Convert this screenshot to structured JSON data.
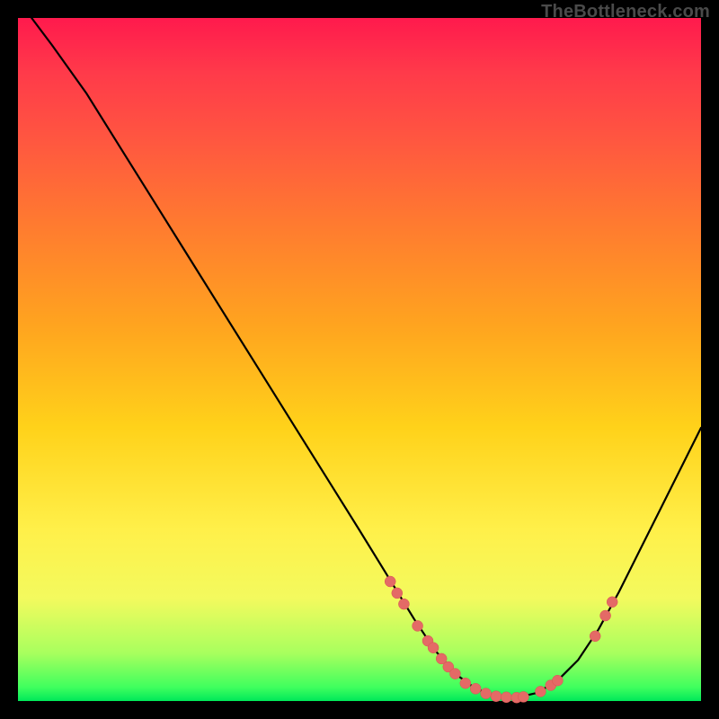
{
  "watermark": "TheBottleneck.com",
  "chart_data": {
    "type": "line",
    "title": "",
    "xlabel": "",
    "ylabel": "",
    "xlim": [
      0,
      100
    ],
    "ylim": [
      0,
      100
    ],
    "grid": false,
    "curve": [
      {
        "x": 2.0,
        "y": 100.0
      },
      {
        "x": 5.0,
        "y": 96.0
      },
      {
        "x": 10.0,
        "y": 89.0
      },
      {
        "x": 15.0,
        "y": 81.0
      },
      {
        "x": 20.0,
        "y": 73.0
      },
      {
        "x": 25.0,
        "y": 65.0
      },
      {
        "x": 30.0,
        "y": 57.0
      },
      {
        "x": 35.0,
        "y": 49.0
      },
      {
        "x": 40.0,
        "y": 41.0
      },
      {
        "x": 45.0,
        "y": 33.0
      },
      {
        "x": 50.0,
        "y": 25.0
      },
      {
        "x": 54.0,
        "y": 18.5
      },
      {
        "x": 58.0,
        "y": 12.0
      },
      {
        "x": 61.0,
        "y": 7.5
      },
      {
        "x": 64.0,
        "y": 4.0
      },
      {
        "x": 67.0,
        "y": 1.8
      },
      {
        "x": 70.0,
        "y": 0.7
      },
      {
        "x": 73.0,
        "y": 0.5
      },
      {
        "x": 76.0,
        "y": 1.2
      },
      {
        "x": 79.0,
        "y": 3.0
      },
      {
        "x": 82.0,
        "y": 6.0
      },
      {
        "x": 85.0,
        "y": 10.5
      },
      {
        "x": 88.0,
        "y": 16.0
      },
      {
        "x": 91.0,
        "y": 22.0
      },
      {
        "x": 94.0,
        "y": 28.0
      },
      {
        "x": 97.0,
        "y": 34.0
      },
      {
        "x": 100.0,
        "y": 40.0
      }
    ],
    "highlight_points": [
      {
        "x": 54.5,
        "y": 17.5
      },
      {
        "x": 55.5,
        "y": 15.8
      },
      {
        "x": 56.5,
        "y": 14.2
      },
      {
        "x": 58.5,
        "y": 11.0
      },
      {
        "x": 60.0,
        "y": 8.8
      },
      {
        "x": 60.8,
        "y": 7.8
      },
      {
        "x": 62.0,
        "y": 6.2
      },
      {
        "x": 63.0,
        "y": 5.0
      },
      {
        "x": 64.0,
        "y": 4.0
      },
      {
        "x": 65.5,
        "y": 2.6
      },
      {
        "x": 67.0,
        "y": 1.8
      },
      {
        "x": 68.5,
        "y": 1.1
      },
      {
        "x": 70.0,
        "y": 0.7
      },
      {
        "x": 71.5,
        "y": 0.55
      },
      {
        "x": 73.0,
        "y": 0.5
      },
      {
        "x": 74.0,
        "y": 0.6
      },
      {
        "x": 76.5,
        "y": 1.4
      },
      {
        "x": 78.0,
        "y": 2.3
      },
      {
        "x": 79.0,
        "y": 3.0
      },
      {
        "x": 84.5,
        "y": 9.5
      },
      {
        "x": 86.0,
        "y": 12.5
      },
      {
        "x": 87.0,
        "y": 14.5
      }
    ],
    "point_color": "#e46a66"
  }
}
